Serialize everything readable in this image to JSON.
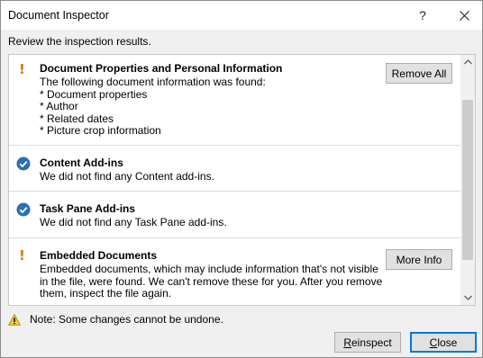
{
  "window": {
    "title": "Document Inspector",
    "help_label": "?"
  },
  "instruction": "Review the inspection results.",
  "sections": [
    {
      "status": "warning",
      "title": "Document Properties and Personal Information",
      "body": "The following document information was found:\n* Document properties\n* Author\n* Related dates\n* Picture crop information",
      "button": "Remove All"
    },
    {
      "status": "ok",
      "title": "Content Add-ins",
      "body": "We did not find any Content add-ins."
    },
    {
      "status": "ok",
      "title": "Task Pane Add-ins",
      "body": "We did not find any Task Pane add-ins."
    },
    {
      "status": "warning",
      "title": "Embedded Documents",
      "body": "Embedded documents, which may include information that's not visible\nin the file, were found. We can't remove these for you. After you remove\nthem, inspect the file again.",
      "button": "More Info"
    }
  ],
  "note": "Note: Some changes cannot be undone.",
  "buttons": {
    "reinspect": "Reinspect",
    "close": "Close"
  },
  "colors": {
    "warning": "#d27a00",
    "ok": "#2d6db5",
    "accent": "#0078d7"
  },
  "icons": {
    "warning": "exclamation-icon",
    "ok": "checkmark-circle-icon",
    "note": "warning-triangle-icon"
  }
}
